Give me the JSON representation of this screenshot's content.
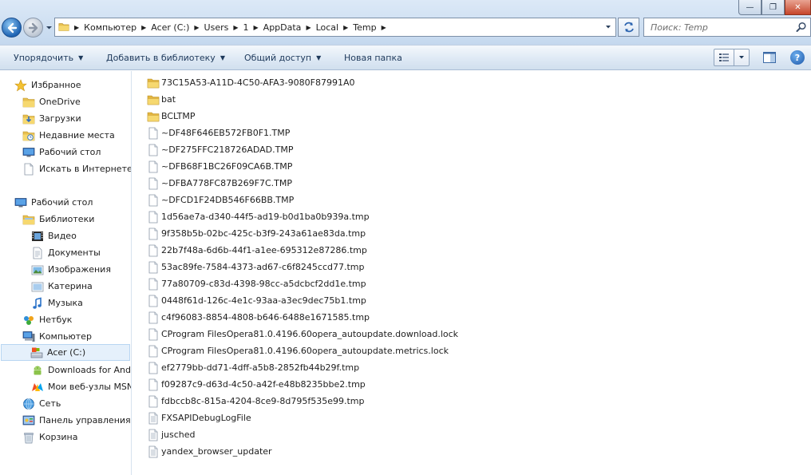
{
  "window": {
    "minimize_glyph": "—",
    "maximize_glyph": "❐",
    "close_glyph": "✕"
  },
  "address": {
    "crumbs": [
      "Компьютер",
      "Acer (C:)",
      "Users",
      "1",
      "AppData",
      "Local",
      "Temp"
    ]
  },
  "search": {
    "placeholder": "Поиск: Temp"
  },
  "toolbar": {
    "organize": "Упорядочить",
    "add_to_library": "Добавить в библиотеку",
    "share": "Общий доступ",
    "new_folder": "Новая папка"
  },
  "navpane": {
    "items": [
      {
        "label": "Избранное",
        "icon": "star-icon"
      },
      {
        "label": "OneDrive",
        "icon": "folder-icon"
      },
      {
        "label": "Загрузки",
        "icon": "downloads-icon"
      },
      {
        "label": "Недавние места",
        "icon": "recent-places-icon"
      },
      {
        "label": "Рабочий стол",
        "icon": "desktop-icon"
      },
      {
        "label": "Искать в Интернете",
        "icon": "web-search-icon"
      },
      {
        "label": "Рабочий стол",
        "icon": "desktop-icon"
      },
      {
        "label": "Библиотеки",
        "icon": "libraries-icon"
      },
      {
        "label": "Видео",
        "icon": "video-icon"
      },
      {
        "label": "Документы",
        "icon": "documents-icon"
      },
      {
        "label": "Изображения",
        "icon": "pictures-icon"
      },
      {
        "label": "Катерина",
        "icon": "user-icon"
      },
      {
        "label": "Музыка",
        "icon": "music-icon"
      },
      {
        "label": "Нетбук",
        "icon": "homegroup-icon"
      },
      {
        "label": "Компьютер",
        "icon": "computer-icon"
      },
      {
        "label": "Acer (C:)",
        "icon": "drive-icon"
      },
      {
        "label": "Downloads for Android",
        "icon": "android-icon"
      },
      {
        "label": "Мои веб-узлы MSN",
        "icon": "msn-icon"
      },
      {
        "label": "Сеть",
        "icon": "network-icon"
      },
      {
        "label": "Панель управления",
        "icon": "control-panel-icon"
      },
      {
        "label": "Корзина",
        "icon": "recycle-bin-icon"
      }
    ]
  },
  "files": [
    {
      "name": "73C15A53-A11D-4C50-AFA3-9080F87991A0",
      "type": "folder"
    },
    {
      "name": "bat",
      "type": "folder"
    },
    {
      "name": "BCLTMP",
      "type": "folder"
    },
    {
      "name": "~DF48F646EB572FB0F1.TMP",
      "type": "file"
    },
    {
      "name": "~DF275FFC218726ADAD.TMP",
      "type": "file"
    },
    {
      "name": "~DFB68F1BC26F09CA6B.TMP",
      "type": "file"
    },
    {
      "name": "~DFBA778FC87B269F7C.TMP",
      "type": "file"
    },
    {
      "name": "~DFCD1F24DB546F66BB.TMP",
      "type": "file"
    },
    {
      "name": "1d56ae7a-d340-44f5-ad19-b0d1ba0b939a.tmp",
      "type": "file"
    },
    {
      "name": "9f358b5b-02bc-425c-b3f9-243a61ae83da.tmp",
      "type": "file"
    },
    {
      "name": "22b7f48a-6d6b-44f1-a1ee-695312e87286.tmp",
      "type": "file"
    },
    {
      "name": "53ac89fe-7584-4373-ad67-c6f8245ccd77.tmp",
      "type": "file"
    },
    {
      "name": "77a80709-c83d-4398-98cc-a5dcbcf2dd1e.tmp",
      "type": "file"
    },
    {
      "name": "0448f61d-126c-4e1c-93aa-a3ec9dec75b1.tmp",
      "type": "file"
    },
    {
      "name": "c4f96083-8854-4808-b646-6488e1671585.tmp",
      "type": "file"
    },
    {
      "name": "CProgram FilesOpera81.0.4196.60opera_autoupdate.download.lock",
      "type": "file"
    },
    {
      "name": "CProgram FilesOpera81.0.4196.60opera_autoupdate.metrics.lock",
      "type": "file"
    },
    {
      "name": "ef2779bb-dd71-4dff-a5b8-2852fb44b29f.tmp",
      "type": "file"
    },
    {
      "name": "f09287c9-d63d-4c50-a42f-e48b8235bbe2.tmp",
      "type": "file"
    },
    {
      "name": "fdbccb8c-815a-4204-8ce9-8d795f535e99.tmp",
      "type": "file"
    },
    {
      "name": "FXSAPIDebugLogFile",
      "type": "text"
    },
    {
      "name": "jusched",
      "type": "text"
    },
    {
      "name": "yandex_browser_updater",
      "type": "text"
    }
  ]
}
